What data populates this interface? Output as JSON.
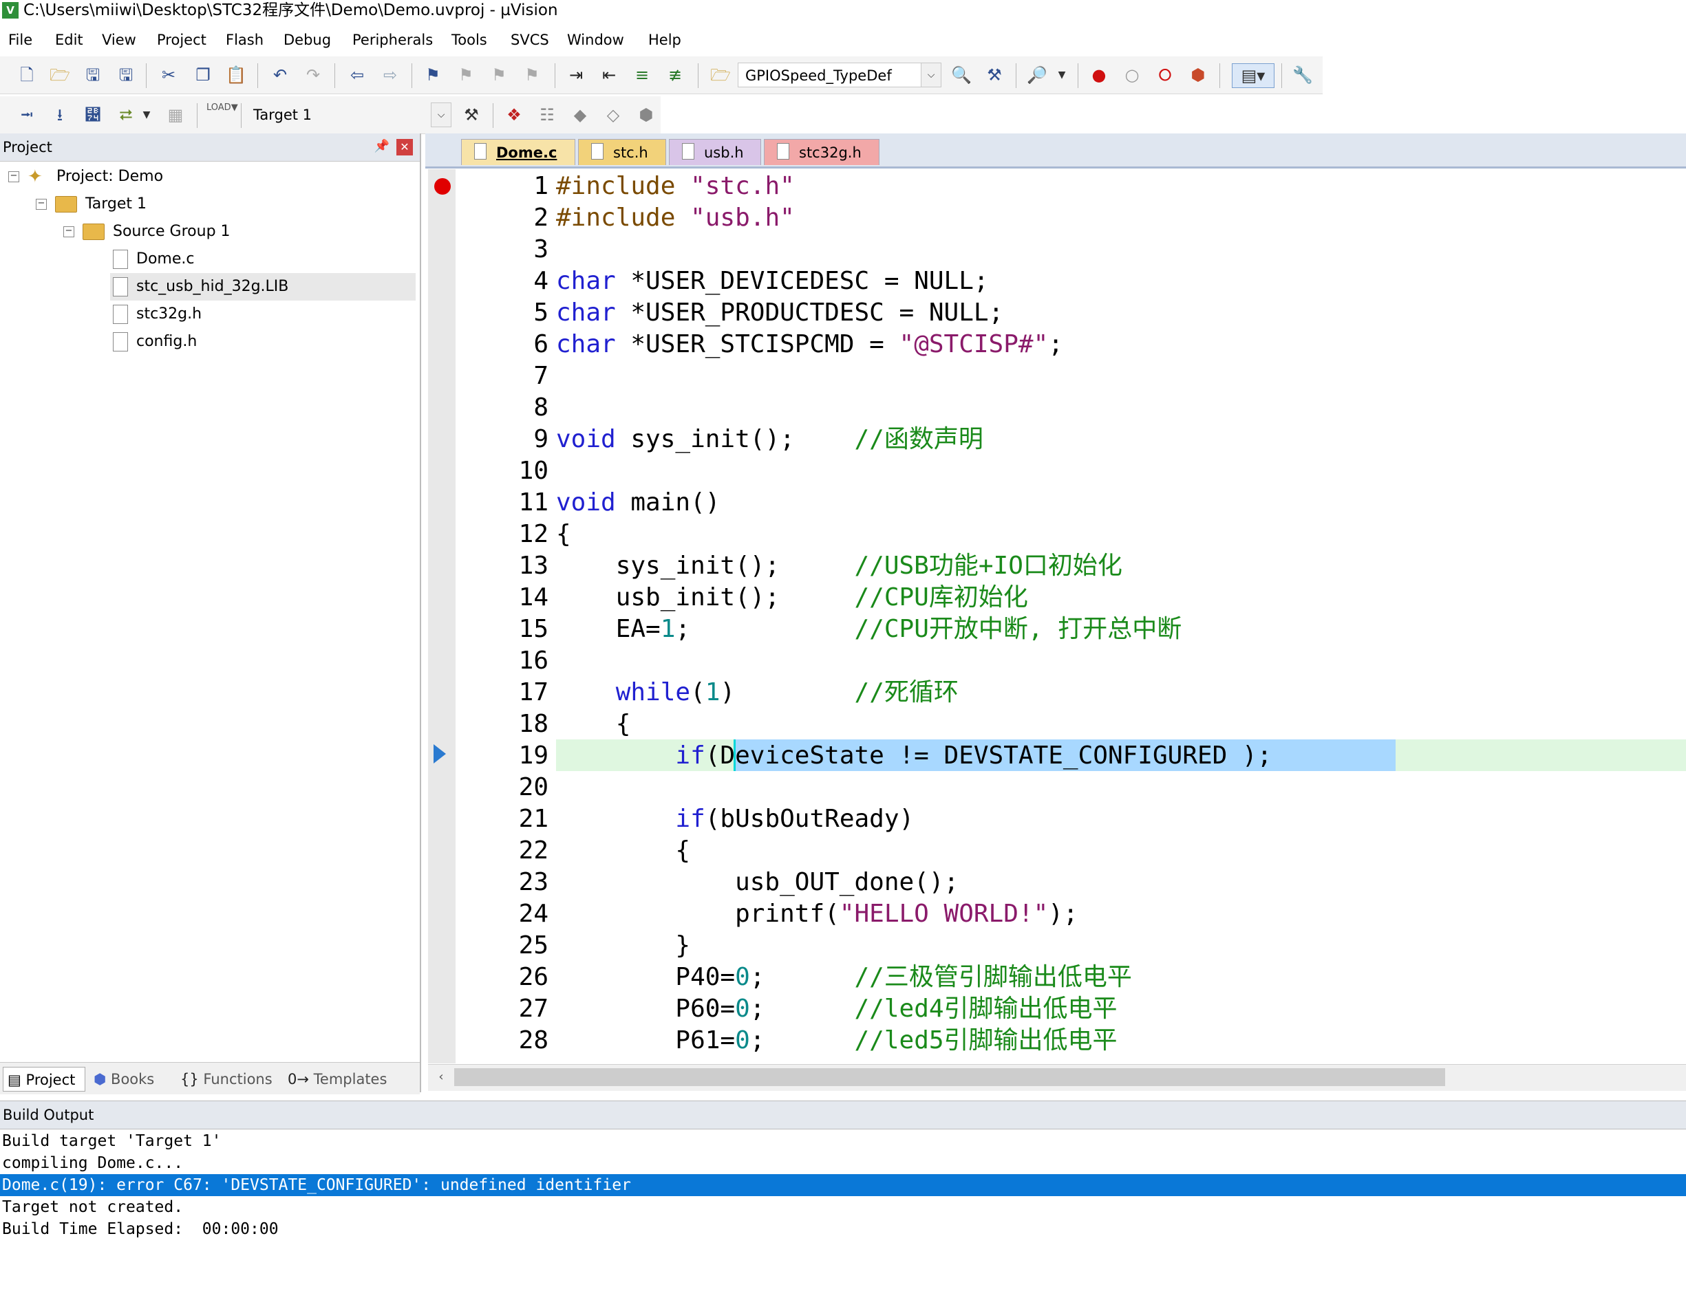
{
  "title": "C:\\Users\\miiwi\\Desktop\\STC32程序文件\\Demo\\Demo.uvproj - µVision",
  "menu": [
    "File",
    "Edit",
    "View",
    "Project",
    "Flash",
    "Debug",
    "Peripherals",
    "Tools",
    "SVCS",
    "Window",
    "Help"
  ],
  "toolbar": {
    "function_combo": "GPIOSpeed_TypeDef",
    "target_combo": "Target 1",
    "target_load_label": "LOAD"
  },
  "project_panel": {
    "header": "Project",
    "tree": {
      "project": "Project: Demo",
      "target": "Target 1",
      "group": "Source Group 1",
      "files": [
        "Dome.c",
        "stc_usb_hid_32g.LIB",
        "stc32g.h",
        "config.h"
      ],
      "selected_file": "stc_usb_hid_32g.LIB"
    },
    "tabs": [
      "Project",
      "Books",
      "Functions",
      "Templates"
    ],
    "active_tab": "Project"
  },
  "editor": {
    "tabs": [
      {
        "label": "Dome.c",
        "active": true,
        "color": "#f7e3a8"
      },
      {
        "label": "stc.h",
        "active": false,
        "color": "#f2d27a"
      },
      {
        "label": "usb.h",
        "active": false,
        "color": "#d9c5e8"
      },
      {
        "label": "stc32g.h",
        "active": false,
        "color": "#f2a8a8"
      }
    ],
    "breakpoint_line": 1,
    "current_line": 19,
    "lines": [
      {
        "n": "1",
        "text": "#include \"stc.h\""
      },
      {
        "n": "2",
        "text": "#include \"usb.h\""
      },
      {
        "n": "3",
        "text": ""
      },
      {
        "n": "4",
        "text": "char *USER_DEVICEDESC = NULL;"
      },
      {
        "n": "5",
        "text": "char *USER_PRODUCTDESC = NULL;"
      },
      {
        "n": "6",
        "text": "char *USER_STCISPCMD = \"@STCISP#\";"
      },
      {
        "n": "7",
        "text": ""
      },
      {
        "n": "8",
        "text": ""
      },
      {
        "n": "9",
        "text": "void sys_init();    //函数声明"
      },
      {
        "n": "10",
        "text": ""
      },
      {
        "n": "11",
        "text": "void main()"
      },
      {
        "n": "12",
        "text": "{"
      },
      {
        "n": "13",
        "text": "    sys_init();     //USB功能+IO口初始化"
      },
      {
        "n": "14",
        "text": "    usb_init();     //CPU库初始化"
      },
      {
        "n": "15",
        "text": "    EA=1;           //CPU开放中断, 打开总中断"
      },
      {
        "n": "16",
        "text": ""
      },
      {
        "n": "17",
        "text": "    while(1)        //死循环"
      },
      {
        "n": "18",
        "text": "    {"
      },
      {
        "n": "19",
        "text": "        if(DeviceState != DEVSTATE_CONFIGURED );"
      },
      {
        "n": "20",
        "text": ""
      },
      {
        "n": "21",
        "text": "        if(bUsbOutReady)"
      },
      {
        "n": "22",
        "text": "        {"
      },
      {
        "n": "23",
        "text": "            usb_OUT_done();"
      },
      {
        "n": "24",
        "text": "            printf(\"HELLO WORLD!\");"
      },
      {
        "n": "25",
        "text": "        }"
      },
      {
        "n": "26",
        "text": "        P40=0;      //三极管引脚输出低电平"
      },
      {
        "n": "27",
        "text": "        P60=0;      //led4引脚输出低电平"
      },
      {
        "n": "28",
        "text": "        P61=0;      //led5引脚输出低电平"
      }
    ]
  },
  "build_output": {
    "header": "Build Output",
    "lines": [
      "Build target 'Target 1'",
      "compiling Dome.c...",
      "Dome.c(19): error C67: 'DEVSTATE_CONFIGURED': undefined identifier",
      "Target not created.",
      "Build Time Elapsed:  00:00:00"
    ],
    "highlighted_line": 2
  },
  "colors": {
    "selection": "#0a78d7",
    "current_line_bg": "#dff7e0",
    "selection_code": "#a8d8ff",
    "breakpoint": "#e00000"
  }
}
